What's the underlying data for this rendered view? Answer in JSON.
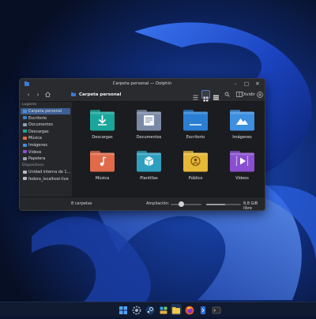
{
  "window": {
    "title": "Carpeta personal — Dolphin"
  },
  "toolbar": {
    "breadcrumb": "Carpeta personal",
    "divide_label": "Dividir"
  },
  "sidebar": {
    "places_header": "Lugares",
    "places": [
      {
        "label": "Carpeta personal",
        "icon": "home-folder-icon",
        "active": true
      },
      {
        "label": "Escritorio",
        "icon": "desktop-folder-icon"
      },
      {
        "label": "Documentos",
        "icon": "documents-folder-icon"
      },
      {
        "label": "Descargas",
        "icon": "downloads-folder-icon"
      },
      {
        "label": "Música",
        "icon": "music-folder-icon"
      },
      {
        "label": "Imágenes",
        "icon": "pictures-folder-icon"
      },
      {
        "label": "Vídeos",
        "icon": "videos-folder-icon"
      },
      {
        "label": "Papelera",
        "icon": "trash-icon"
      }
    ],
    "devices_header": "Dispositivos",
    "devices": [
      {
        "label": "Unidad interna de 1…",
        "icon": "drive-icon"
      },
      {
        "label": "fedora_localhost-live",
        "icon": "drive-icon"
      }
    ]
  },
  "main": {
    "folders": [
      {
        "label": "Descargas",
        "icon": "download-arrow-icon",
        "color": "#1aa69c"
      },
      {
        "label": "Documentos",
        "icon": "document-lines-icon",
        "color": "#7a8aa6"
      },
      {
        "label": "Escritorio",
        "icon": "desktop-icon",
        "color": "#2a7fd4"
      },
      {
        "label": "Imágenes",
        "icon": "mountain-image-icon",
        "color": "#3d8fe0"
      },
      {
        "label": "Música",
        "icon": "music-note-icon",
        "color": "#e06a4a"
      },
      {
        "label": "Plantillas",
        "icon": "template-cube-icon",
        "color": "#2f9fbf"
      },
      {
        "label": "Público",
        "icon": "person-icon",
        "color": "#e6b838"
      },
      {
        "label": "Vídeos",
        "icon": "play-icon",
        "color": "#8a4fd0"
      }
    ]
  },
  "status": {
    "count": "8 carpetas",
    "zoom_label": "Ampliación:",
    "zoom_level": 0.35,
    "free_label": "8,8 GiB libre",
    "disk_used_fraction": 0.55
  },
  "taskbar": {
    "apps": [
      "windows-start-icon",
      "settings-icon",
      "steam-icon",
      "widgets-icon",
      "file-manager-icon",
      "firefox-icon",
      "kde-connect-icon",
      "terminal-icon"
    ]
  },
  "colors": {
    "accent": "#3d5f93",
    "window_bg": "#1f2023",
    "wallpaper": "#0b1730"
  }
}
